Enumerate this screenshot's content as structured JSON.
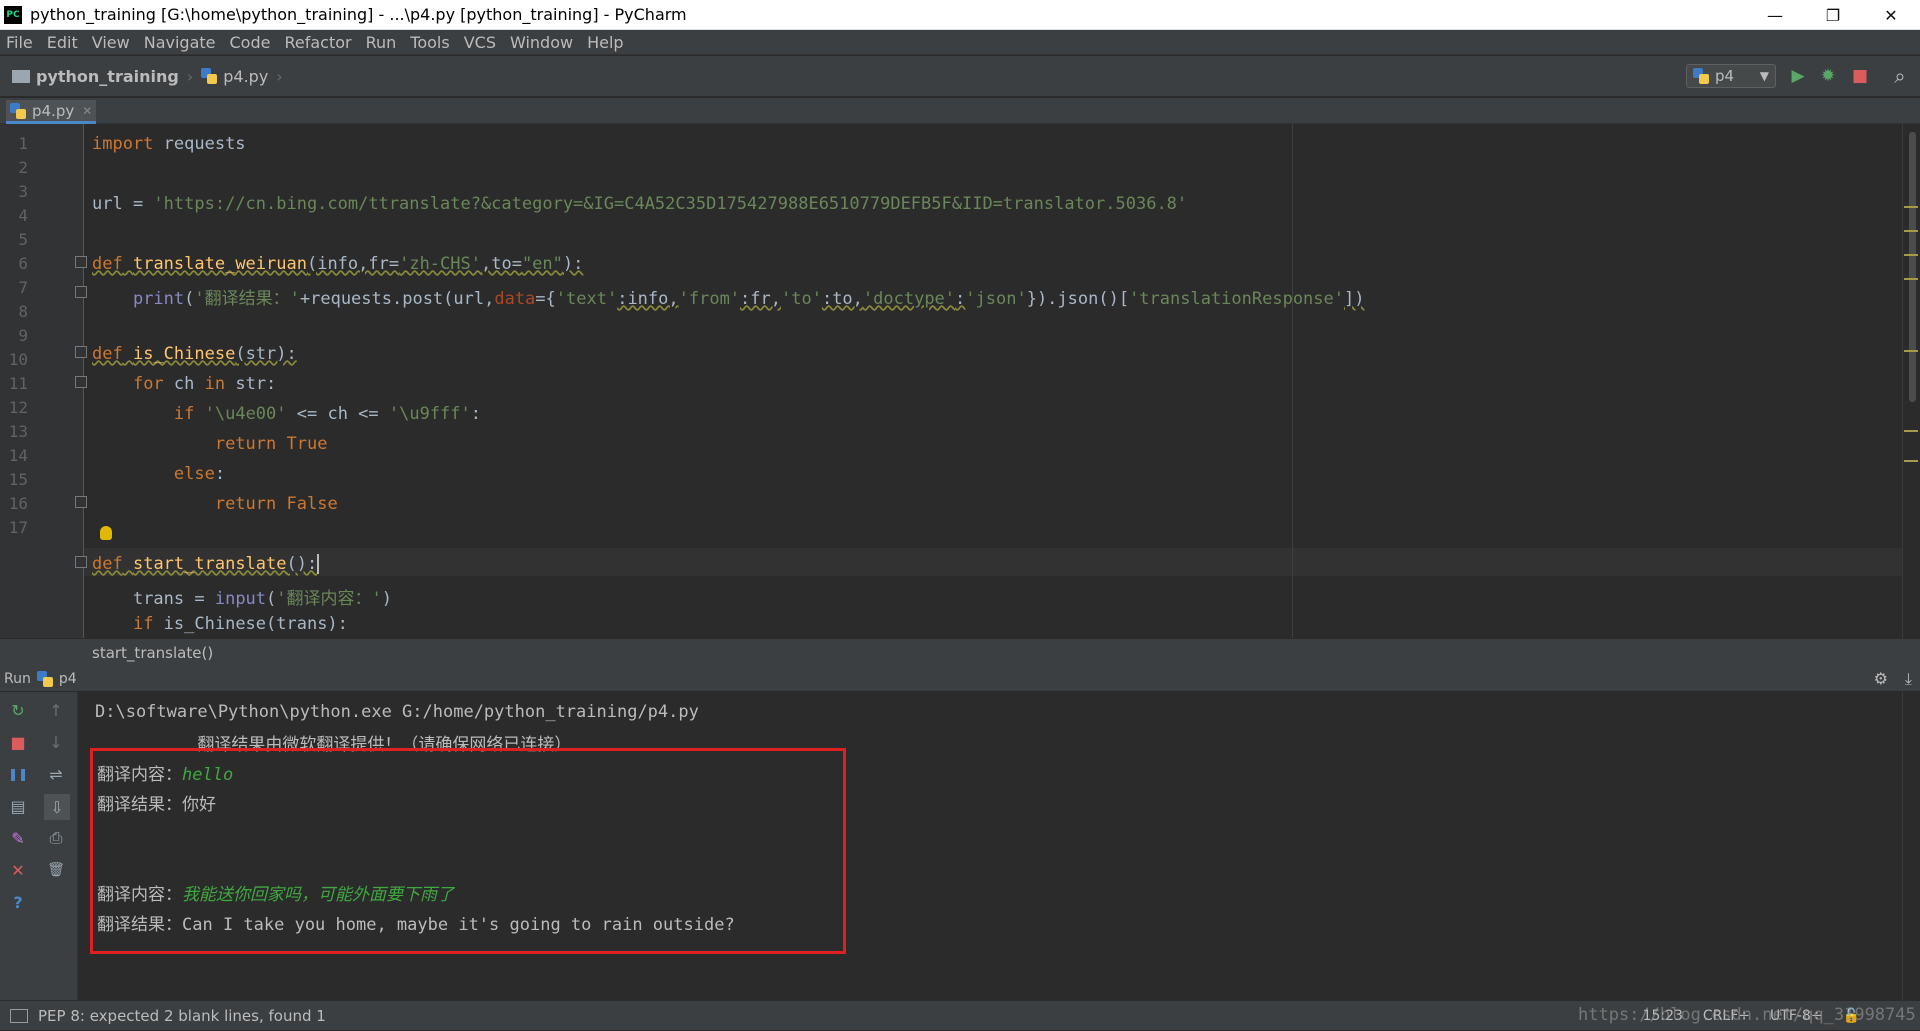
{
  "window": {
    "title": "python_training [G:\\home\\python_training] - ...\\p4.py [python_training] - PyCharm",
    "app_icon": "PC",
    "minimize": "—",
    "restore": "❐",
    "close": "✕"
  },
  "menu": [
    "File",
    "Edit",
    "View",
    "Navigate",
    "Code",
    "Refactor",
    "Run",
    "Tools",
    "VCS",
    "Window",
    "Help"
  ],
  "breadcrumb": {
    "project": "python_training",
    "file": "p4.py",
    "sep": "›"
  },
  "toolbar": {
    "run_config": "p4",
    "dropdown": "▼",
    "run_icon": "▶",
    "debug_icon": "✹",
    "stop_icon": "■",
    "search_icon": "⌕"
  },
  "tabs": [
    {
      "label": "p4.py",
      "close": "✕"
    }
  ],
  "editor": {
    "line_numbers": [
      "1",
      "2",
      "3",
      "4",
      "5",
      "6",
      "7",
      "8",
      "9",
      "10",
      "11",
      "12",
      "13",
      "14",
      "15",
      "16",
      "17"
    ],
    "line1": {
      "kw": "import",
      "rest": " requests"
    },
    "line3": {
      "lhs": "url = ",
      "str": "'https://cn.bing.com/ttranslate?&category=&IG=C4A52C35D175427988E6510779DEFB5F&IID=translator.5036.8'"
    },
    "line5": {
      "kw": "def",
      "sp": " ",
      "fn": "translate_weiruan",
      "a": "(info,fr=",
      "s1": "'zh-CHS'",
      "b": ",to=",
      "s2": "\"en\"",
      "c": "):"
    },
    "line6": {
      "indent": "    ",
      "bi": "print",
      "a": "(",
      "s1": "'翻译结果：'",
      "b": "+requests.post(url,",
      "prm": "data",
      "c": "={",
      "s2": "'text'",
      "d": ":info,",
      "s3": "'from'",
      "e": ":fr,",
      "s4": "'to'",
      "f": ":to,",
      "s5": "'doctype'",
      "g": ":",
      "s6": "'json'",
      "h": "}).json()[",
      "s7": "'translationResponse'",
      "i": "])"
    },
    "line8": {
      "kw": "def",
      "sp": " ",
      "fn": "is_Chinese",
      "rest": "(str):"
    },
    "line9": {
      "indent": "    ",
      "kw1": "for",
      "a": " ch ",
      "kw2": "in",
      "b": " str:"
    },
    "line10": {
      "indent": "        ",
      "kw": "if",
      "sp": " ",
      "s1": "'\\u4e00'",
      "a": " <= ch <= ",
      "s2": "'\\u9fff'",
      "b": ":"
    },
    "line11": {
      "indent": "            ",
      "kw": "return",
      "a": " ",
      "kw2": "True"
    },
    "line12": {
      "indent": "        ",
      "kw": "else",
      "a": ":"
    },
    "line13": {
      "indent": "            ",
      "kw": "return",
      "a": " ",
      "kw2": "False"
    },
    "line15": {
      "kw": "def",
      "sp": " ",
      "fn": "start_translate",
      "rest": "():"
    },
    "line16": {
      "indent": "    ",
      "a": "trans = ",
      "bi": "input",
      "b": "(",
      "s1": "'翻译内容：'",
      "c": ")"
    },
    "line17": {
      "indent": "    ",
      "kw": "if",
      "rest": " is_Chinese(trans):"
    }
  },
  "context_crumb": "start_translate()",
  "run_panel": {
    "label": "Run",
    "config": "p4",
    "gear": "⚙",
    "pin": "⤓"
  },
  "run_tools": {
    "rerun": "↻",
    "stop": "■",
    "pause": "❚❚",
    "layout": "▤",
    "pin": "✎",
    "close": "✕",
    "help": "?",
    "up": "↑",
    "down": "↓",
    "wrap": "⇌",
    "scroll": "⇩",
    "print": "⎙",
    "trash": "🗑"
  },
  "console": {
    "cmd": "D:\\software\\Python\\python.exe G:/home/python_training/p4.py",
    "banner": "          翻译结果由微软翻译提供！（请确保网络已连接）",
    "q1_label": "翻译内容：",
    "q1_input": "hello",
    "a1": "翻译结果：你好",
    "q2_label": "翻译内容：",
    "q2_input": "我能送你回家吗，可能外面要下雨了",
    "a2": "翻译结果：Can I take you home, maybe it's going to rain outside?"
  },
  "status": {
    "message": "PEP 8: expected 2 blank lines, found 1",
    "position": "15:23",
    "line_sep": "CRLF÷",
    "encoding": "UTF-8÷",
    "watermark": "https://blog.csdn.net/qq_31998745"
  },
  "colors": {
    "highlight_box": "#e02020",
    "keyword": "#cc7832",
    "string": "#6a8759",
    "function": "#ffc66d"
  }
}
